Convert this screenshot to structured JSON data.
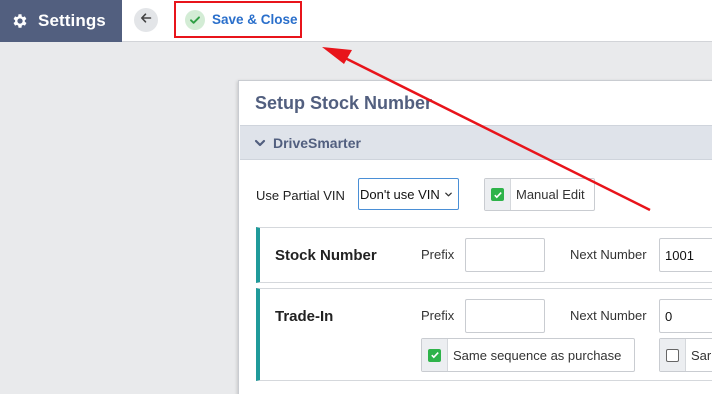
{
  "header": {
    "title": "Settings",
    "save_close_label": "Save & Close"
  },
  "icons": {
    "settings": "gear-icon",
    "back": "arrow-left-icon",
    "save": "check-icon",
    "section": "chevron-down-icon"
  },
  "colors": {
    "settings_bg": "#525f7f",
    "accent_link": "#2a6fcb",
    "annotation_red": "#e8141b",
    "check_green": "#2eb34a",
    "row_accent": "#1f9a9a"
  },
  "panel": {
    "title": "Setup Stock Number",
    "section_label": "DriveSmarter",
    "partial_vin_label": "Use Partial VIN",
    "partial_vin_value": "Don't use VIN",
    "manual_edit_label": "Manual Edit",
    "manual_edit_checked": true,
    "rows": [
      {
        "title": "Stock Number",
        "prefix_label": "Prefix",
        "prefix_value": "",
        "next_label": "Next Number",
        "next_value": "1001"
      },
      {
        "title": "Trade-In",
        "prefix_label": "Prefix",
        "prefix_value": "",
        "next_label": "Next Number",
        "next_value": "0",
        "same_seq_label": "Same sequence as purchase",
        "same_seq_checked": true,
        "second_option_label": "Sar",
        "second_option_checked": false
      }
    ]
  }
}
